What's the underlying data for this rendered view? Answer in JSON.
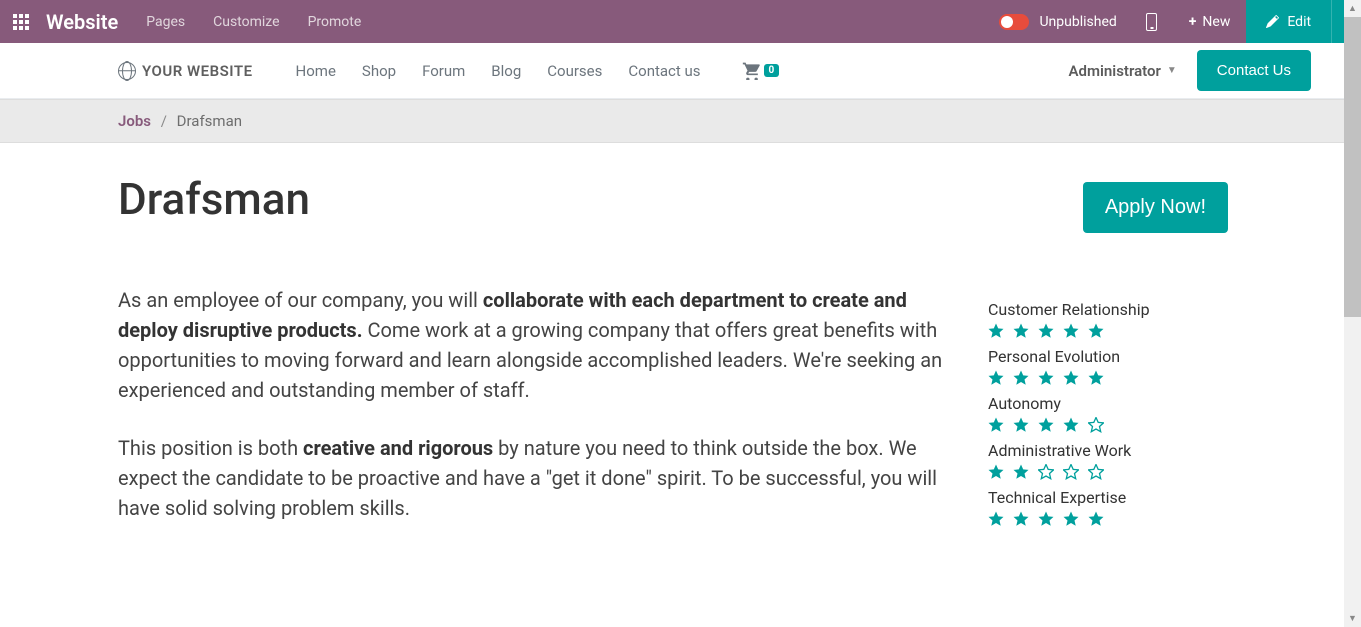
{
  "topbar": {
    "brand": "Website",
    "menu": [
      "Pages",
      "Customize",
      "Promote"
    ],
    "publish_state": "Unpublished",
    "new_label": "New",
    "edit_label": "Edit"
  },
  "header": {
    "logo_text": "YOUR WEBSITE",
    "nav": [
      "Home",
      "Shop",
      "Forum",
      "Blog",
      "Courses",
      "Contact us"
    ],
    "cart_count": "0",
    "admin_label": "Administrator",
    "contact_btn": "Contact Us"
  },
  "breadcrumb": {
    "link": "Jobs",
    "current": "Drafsman"
  },
  "job": {
    "title": "Drafsman",
    "apply_label": "Apply Now!",
    "p1_a": "As an employee of our company, you will ",
    "p1_b": "collaborate with each department to create and deploy disruptive products.",
    "p1_c": " Come work at a growing company that offers great benefits with opportunities to moving forward and learn alongside accomplished leaders. We're seeking an experienced and outstanding member of staff.",
    "p2_a": "This position is both ",
    "p2_b": "creative and rigorous",
    "p2_c": " by nature you need to think outside the box. We expect the candidate to be proactive and have a \"get it done\" spirit. To be successful, you will have solid solving problem skills."
  },
  "ratings": [
    {
      "label": "Customer Relationship",
      "stars": 5
    },
    {
      "label": "Personal Evolution",
      "stars": 5
    },
    {
      "label": "Autonomy",
      "stars": 4
    },
    {
      "label": "Administrative Work",
      "stars": 2
    },
    {
      "label": "Technical Expertise",
      "stars": 5
    }
  ]
}
